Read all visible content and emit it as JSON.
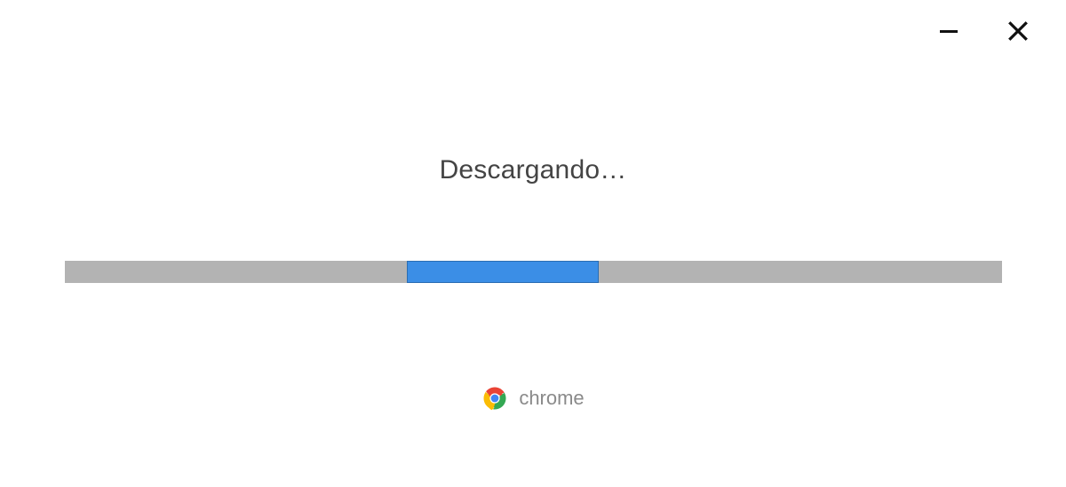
{
  "window": {
    "minimize_tooltip": "Minimize",
    "close_tooltip": "Close"
  },
  "status": {
    "text": "Descargando…"
  },
  "progress": {
    "indeterminate": true,
    "chunk_left_percent": 36.5,
    "chunk_width_percent": 20.5
  },
  "branding": {
    "product_name": "chrome",
    "icon_name": "chrome-logo"
  }
}
